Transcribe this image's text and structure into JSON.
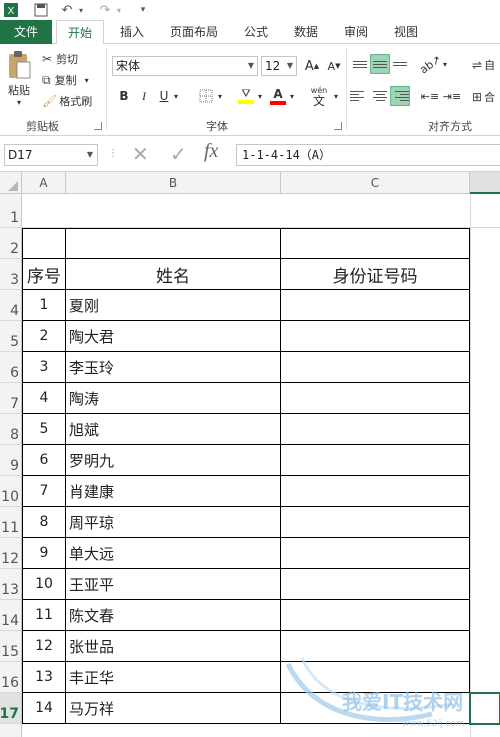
{
  "tabs": [
    {
      "label": "文件"
    },
    {
      "label": "开始"
    },
    {
      "label": "插入"
    },
    {
      "label": "页面布局"
    },
    {
      "label": "公式"
    },
    {
      "label": "数据"
    },
    {
      "label": "审阅"
    },
    {
      "label": "视图"
    }
  ],
  "ribbon": {
    "clipboard": {
      "label": "剪贴板",
      "paste": "粘贴",
      "cut": "剪切",
      "copy": "复制",
      "format_painter": "格式刷"
    },
    "font": {
      "label": "字体",
      "font_name": "宋体",
      "font_size": "12",
      "bold": "B",
      "italic": "I",
      "underline": "U",
      "grow": "A",
      "shrink": "A",
      "phonetic": "wén"
    },
    "alignment": {
      "label": "对齐方式",
      "wrap_text_partial": "自",
      "merge_partial": "合"
    }
  },
  "formula_bar": {
    "name_box": "D17",
    "fx": "fx",
    "formula": "1-1-4-14（A）"
  },
  "columns": [
    {
      "label": "A"
    },
    {
      "label": "B"
    },
    {
      "label": "C"
    }
  ],
  "rows": [
    "1",
    "2",
    "3",
    "4",
    "5",
    "6",
    "7",
    "8",
    "9",
    "10",
    "11",
    "12",
    "13",
    "14",
    "15",
    "16",
    "17"
  ],
  "table": {
    "header": {
      "seq": "序号",
      "name": "姓名",
      "id": "身份证号码"
    },
    "records": [
      {
        "seq": "1",
        "name": "夏刚"
      },
      {
        "seq": "2",
        "name": "陶大君"
      },
      {
        "seq": "3",
        "name": "李玉玲"
      },
      {
        "seq": "4",
        "name": "陶涛"
      },
      {
        "seq": "5",
        "name": "旭斌"
      },
      {
        "seq": "6",
        "name": "罗明九"
      },
      {
        "seq": "7",
        "name": "肖建康"
      },
      {
        "seq": "8",
        "name": "周平琼"
      },
      {
        "seq": "9",
        "name": "单大远"
      },
      {
        "seq": "10",
        "name": "王亚平"
      },
      {
        "seq": "11",
        "name": "陈文春"
      },
      {
        "seq": "12",
        "name": "张世品"
      },
      {
        "seq": "13",
        "name": "丰正华"
      },
      {
        "seq": "14",
        "name": "马万祥"
      }
    ]
  },
  "colors": {
    "accent": "#217346",
    "selected_align": "#9fd5b7"
  }
}
